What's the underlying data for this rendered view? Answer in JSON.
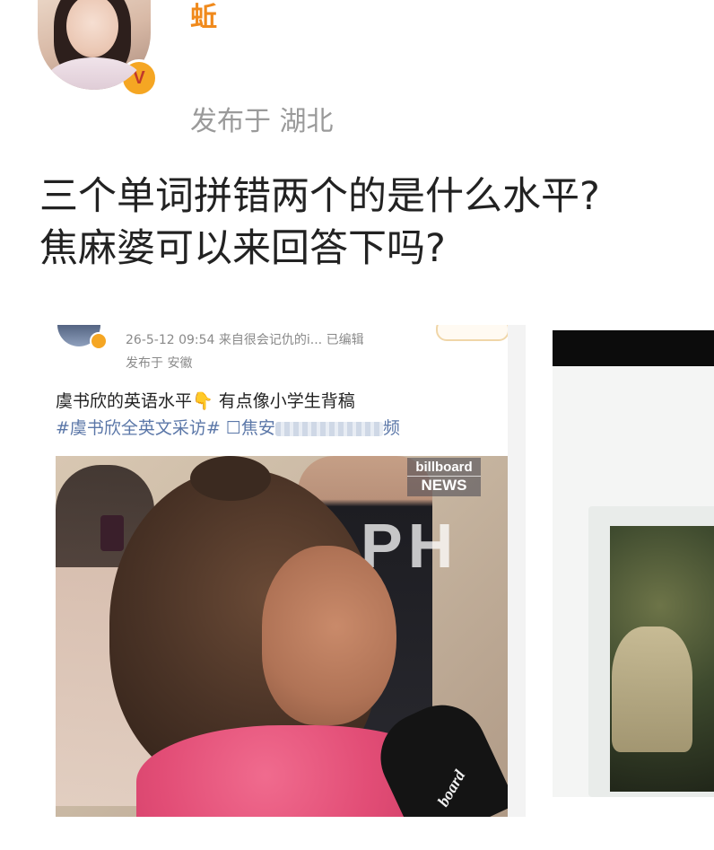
{
  "post": {
    "author_name": "蚯",
    "location": "发布于 湖北",
    "text_line1": "三个单词拼错两个的是什么水平?",
    "text_line2": "焦麻婆可以来回答下吗?"
  },
  "embedded_post": {
    "meta": "26-5-12 09:54  来自很会记仇的i...  已编辑",
    "location": "发布于 安徽",
    "text": "虞书欣的英语水平👇  有点像小学生背稿",
    "hashtags": "#虞书欣全英文采访# ☐焦安",
    "hashtag_tail": "频",
    "photo": {
      "logo_line1": "billboard",
      "logo_line2": "NEWS",
      "wall_text": "PH",
      "mic_label": "board"
    }
  },
  "icons": {
    "verified": "verified-badge-icon"
  },
  "colors": {
    "username": "#f08a1c",
    "location_gray": "#9a9a9a",
    "hashtag_blue": "#5b77a8",
    "badge_orange": "#f5a623",
    "dress_pink": "#e24d76"
  }
}
